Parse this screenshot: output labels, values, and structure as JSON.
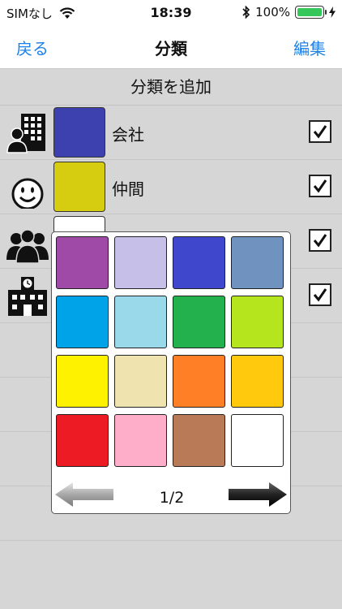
{
  "status": {
    "carrier": "SIMなし",
    "time": "18:39",
    "battery": "100%",
    "battery_level": 1.0
  },
  "nav": {
    "back": "戻る",
    "title": "分類",
    "edit": "編集"
  },
  "add_label": "分類を追加",
  "rows": [
    {
      "label": "会社",
      "icon": "office-worker-icon",
      "color": "#3d41b0",
      "checked": true
    },
    {
      "label": "仲間",
      "icon": "smiley-face-icon",
      "color": "#d6cc10",
      "checked": true
    },
    {
      "label": "",
      "icon": "group-people-icon",
      "color": "#ffffff",
      "checked": true
    },
    {
      "label": "",
      "icon": "school-building-icon",
      "color": "",
      "checked": true
    }
  ],
  "palette": {
    "colors": [
      "#a04aa8",
      "#c6c0e8",
      "#3f48cc",
      "#7092be",
      "#00a2e8",
      "#99d9ea",
      "#22b14c",
      "#b5e61d",
      "#fff200",
      "#efe4b0",
      "#ff7f27",
      "#ffc90e",
      "#ed1c24",
      "#ffaec9",
      "#b97a57",
      "#ffffff"
    ],
    "page": "1/2",
    "arrow_prev": "left-arrow-icon",
    "arrow_next": "right-arrow-icon"
  }
}
